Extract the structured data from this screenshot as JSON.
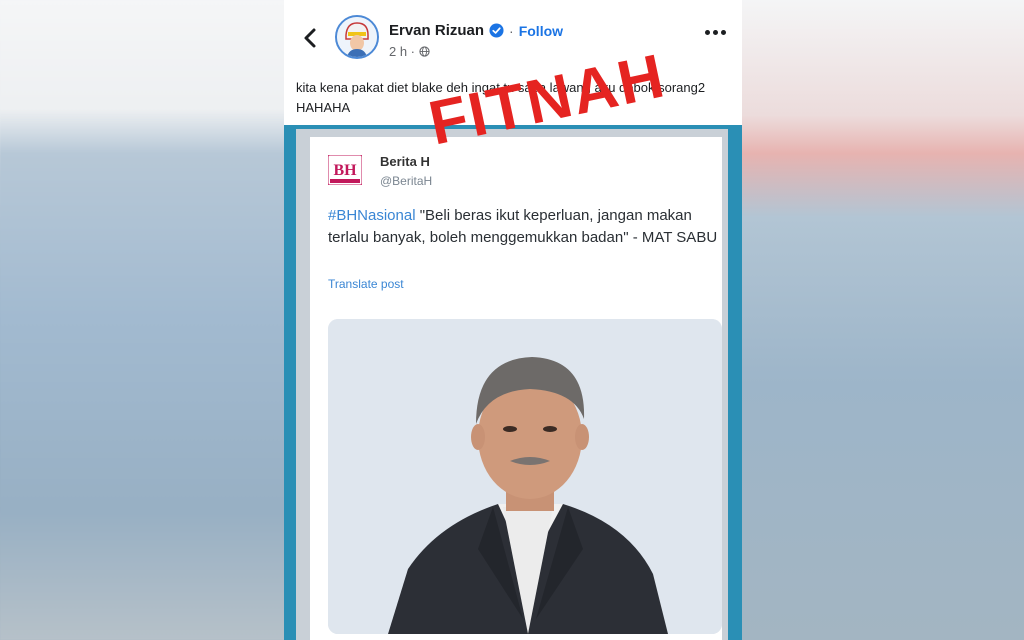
{
  "post": {
    "author": "Ervan Rizuan",
    "follow_label": "Follow",
    "separator": "·",
    "time": "2 h ·",
    "caption": "kita kena pakat diet blake deh ingat tu sapa lawang aku debok sorang2 HAHAHA"
  },
  "tweet": {
    "logo_text": "BH",
    "account_name": "Berita H",
    "handle": "@BeritaH",
    "hashtag": "#BHNasional",
    "quote": " \"Beli beras ikut keperluan, jangan makan terlalu banyak, boleh menggemukkan badan\" - MAT SABU",
    "translate_label": "Translate post"
  },
  "overlay": {
    "stamp_text": "FITNAH"
  },
  "colors": {
    "accent": "#1b74e4",
    "stamp": "#e52421",
    "frame": "#2a8fb5"
  },
  "icons": [
    "back-arrow-icon",
    "verified-badge-icon",
    "globe-icon",
    "more-options-icon"
  ]
}
